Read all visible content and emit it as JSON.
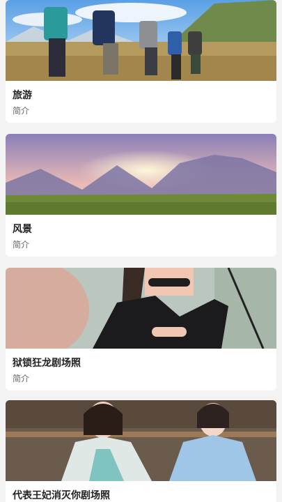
{
  "cards": [
    {
      "title": "旅游",
      "desc": "简介",
      "image": "hikers-in-mountains"
    },
    {
      "title": "风景",
      "desc": "简介",
      "image": "sunset-over-mountains"
    },
    {
      "title": "狱锁狂龙剧场照",
      "desc": "简介",
      "image": "actress-black-outfit"
    },
    {
      "title": "代表王妃消灭你剧场照",
      "desc": "",
      "image": "two-actresses-hanfu"
    }
  ]
}
